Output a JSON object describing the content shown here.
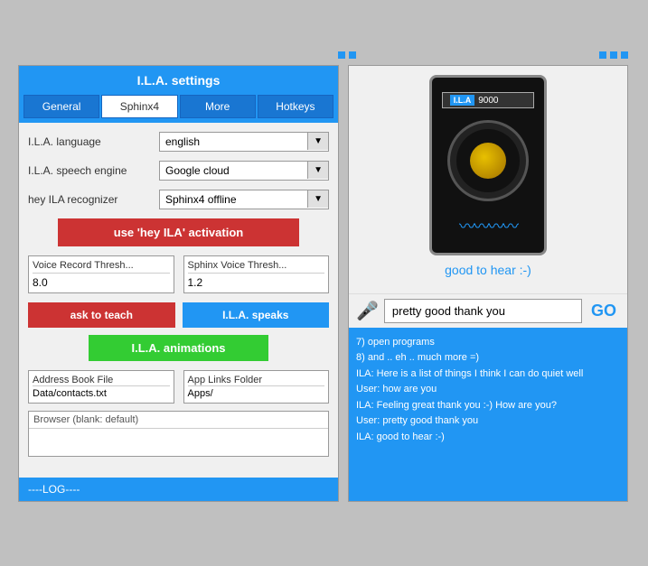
{
  "left": {
    "title": "I.L.A. settings",
    "tabs": [
      {
        "label": "General",
        "active": false
      },
      {
        "label": "Sphinx4",
        "active": true
      },
      {
        "label": "More",
        "active": false
      },
      {
        "label": "Hotkeys",
        "active": false
      }
    ],
    "language_label": "I.L.A. language",
    "language_value": "english",
    "speech_engine_label": "I.L.A. speech engine",
    "speech_engine_value": "Google cloud",
    "recognizer_label": "hey ILA recognizer",
    "recognizer_value": "Sphinx4 offline",
    "activation_btn": "use 'hey ILA' activation",
    "voice_thresh_label": "Voice Record Thresh...",
    "voice_thresh_value": "8.0",
    "sphinx_thresh_label": "Sphinx Voice Thresh...",
    "sphinx_thresh_value": "1.2",
    "teach_btn": "ask to teach",
    "speaks_btn": "I.L.A. speaks",
    "animations_btn": "I.L.A. animations",
    "address_label": "Address Book File",
    "address_value": "Data/contacts.txt",
    "applinks_label": "App Links Folder",
    "applinks_value": "Apps/",
    "browser_label": "Browser (blank: default)",
    "browser_value": "",
    "log_label": "----LOG----"
  },
  "right": {
    "robot_label_ila": "I.L.A",
    "robot_label_num": "9000",
    "status_text": "good to hear :-)",
    "input_placeholder": "pretty good thank you",
    "go_label": "GO",
    "chat_lines": [
      "7) open programs",
      "8) and .. eh .. much more =)",
      "",
      "ILA: Here is a list of things I think I can do quiet well",
      "User: how are you",
      "ILA: Feeling great thank you :-) How are you?",
      "User: pretty good thank you",
      "ILA: good to hear :-)"
    ]
  },
  "dots": {
    "left_color": "#2196F3",
    "right_color": "#2196F3"
  }
}
